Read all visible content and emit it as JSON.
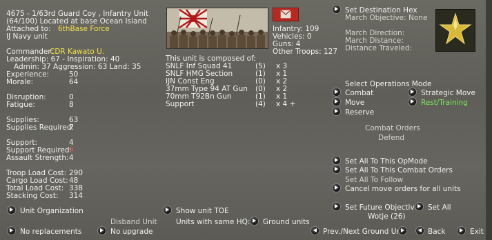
{
  "unit": {
    "title": "4675 - 1/63rd Guard Coy , Infantry Unit",
    "location": "(64/100) Located at base Ocean Island",
    "attached_label": "Attached to:",
    "attached_value": "6thBase Force",
    "unit_type": "IJ Navy unit",
    "commander_label": "Commander:",
    "commander_value": "CDR Kawato U.",
    "leadership_line": "Leadership: 67 - Inspiration: 40",
    "admin_line": "Admin: 37  Aggression: 63  Land: 35"
  },
  "stats": [
    {
      "label": "Experience:",
      "value": "50"
    },
    {
      "label": "Morale:",
      "value": "64"
    },
    {
      "label": "Disruption:",
      "value": "0"
    },
    {
      "label": "Fatigue:",
      "value": "8"
    },
    {
      "label": "Supplies:",
      "value": "63"
    },
    {
      "label": "Supplies Required:",
      "value": "7"
    },
    {
      "label": "Support:",
      "value": "4"
    },
    {
      "label": "Support Required:",
      "value": "9"
    },
    {
      "label": "Assault Strength:",
      "value": "4"
    },
    {
      "label": "Troop Load Cost:",
      "value": "290"
    },
    {
      "label": "Cargo Load Cost:",
      "value": "48"
    },
    {
      "label": "Total Load Cost:",
      "value": "338"
    },
    {
      "label": "Stacking Cost:",
      "value": "314"
    }
  ],
  "troops": [
    {
      "label": "Infantry: 109"
    },
    {
      "label": "Vehicles: 0"
    },
    {
      "label": "Guns: 4"
    },
    {
      "label": "Other Troops: 127"
    }
  ],
  "composition": {
    "header": "This unit is composed of:",
    "rows": [
      {
        "name": "SNLF Inf Squad 41",
        "ready": "(5)",
        "count": "x 3"
      },
      {
        "name": "SNLF HMG Section",
        "ready": "(1)",
        "count": "x 1"
      },
      {
        "name": "IJN Const Eng",
        "ready": "(0)",
        "count": "x 2"
      },
      {
        "name": "37mm Type 94 AT Gun",
        "ready": "(0)",
        "count": "x 2"
      },
      {
        "name": "70mm T92Bn Gun",
        "ready": "(1)",
        "count": "x 1"
      },
      {
        "name": "Support",
        "ready": "(4)",
        "count": "x 4 +"
      }
    ]
  },
  "march": {
    "set_destination": "Set Destination Hex",
    "objective": "March Objective: None",
    "direction": "March Direction:",
    "distance": "March Distance:",
    "traveled": "Distance Traveled:"
  },
  "opmode": {
    "header": "Select Operations Mode",
    "combat": "Combat",
    "strategic": "Strategic Move",
    "move": "Move",
    "rest": "Rest/Training",
    "reserve": "Reserve",
    "combat_orders": "Combat Orders",
    "defend": "Defend"
  },
  "actions": {
    "set_all_opmode": "Set All To This OpMode",
    "set_all_combat": "Set All To This Combat Orders",
    "set_all_follow": "Set All To Follow",
    "cancel_move": "Cancel move orders for all units",
    "set_future": "Set Future Objective",
    "set_all": "Set All",
    "future_value": "Wotje (26)"
  },
  "bottom": {
    "unit_org": "Unit Organization",
    "no_replacements": "No replacements",
    "disband": "Disband Unit",
    "no_upgrade": "No upgrade",
    "show_toe": "Show unit TOE",
    "same_hq": "Units with same HQ:",
    "ground_units": "Ground units",
    "prev_next": "Prev./Next Ground Unit",
    "back": "Back",
    "exit": "Exit"
  },
  "colors": {
    "highlight": "#f2e24a",
    "alert": "#e0505a",
    "active": "#7ce85a"
  }
}
